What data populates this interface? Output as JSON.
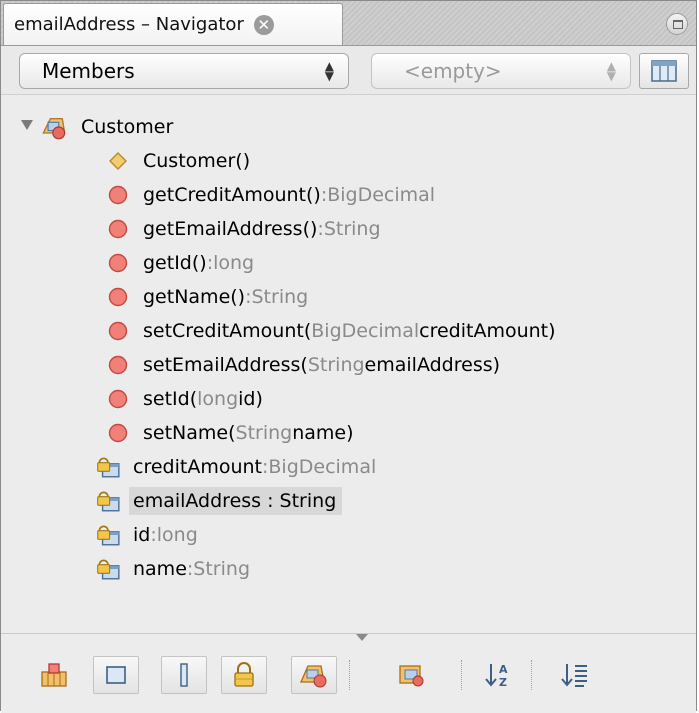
{
  "window": {
    "tab_title": "emailAddress – Navigator",
    "close_glyph": "✕"
  },
  "combos": {
    "members": "Members",
    "filter": "<empty>"
  },
  "tree": {
    "root": "Customer",
    "items": [
      {
        "icon": "constructor-icon",
        "name": "Customer()",
        "type": ""
      },
      {
        "icon": "method-icon",
        "name": "getCreditAmount()",
        "sep": " : ",
        "type": "BigDecimal"
      },
      {
        "icon": "method-icon",
        "name": "getEmailAddress()",
        "sep": " : ",
        "type": "String"
      },
      {
        "icon": "method-icon",
        "name": "getId()",
        "sep": " : ",
        "type": "long"
      },
      {
        "icon": "method-icon",
        "name": "getName()",
        "sep": " : ",
        "type": "String"
      },
      {
        "icon": "method-icon",
        "name": "setCreditAmount(",
        "ptype": "BigDecimal",
        "pname": " creditAmount)"
      },
      {
        "icon": "method-icon",
        "name": "setEmailAddress(",
        "ptype": "String",
        "pname": " emailAddress)"
      },
      {
        "icon": "method-icon",
        "name": "setId(",
        "ptype": "long",
        "pname": " id)"
      },
      {
        "icon": "method-icon",
        "name": "setName(",
        "ptype": "String",
        "pname": " name)"
      },
      {
        "icon": "field-icon",
        "name": "creditAmount",
        "sep": " : ",
        "type": "BigDecimal"
      },
      {
        "icon": "field-icon",
        "name": "emailAddress : String",
        "selected": true
      },
      {
        "icon": "field-icon",
        "name": "id",
        "sep": " : ",
        "type": "long"
      },
      {
        "icon": "field-icon",
        "name": "name",
        "sep": " : ",
        "type": "String"
      }
    ]
  },
  "toolbar": {
    "buttons": [
      "show-inherited-icon",
      "show-fields-icon",
      "show-static-icon",
      "show-nonpublic-icon",
      "show-inner-classes-icon",
      "fully-qualified-names-icon",
      "sort-by-name-icon",
      "sort-by-source-icon"
    ]
  }
}
